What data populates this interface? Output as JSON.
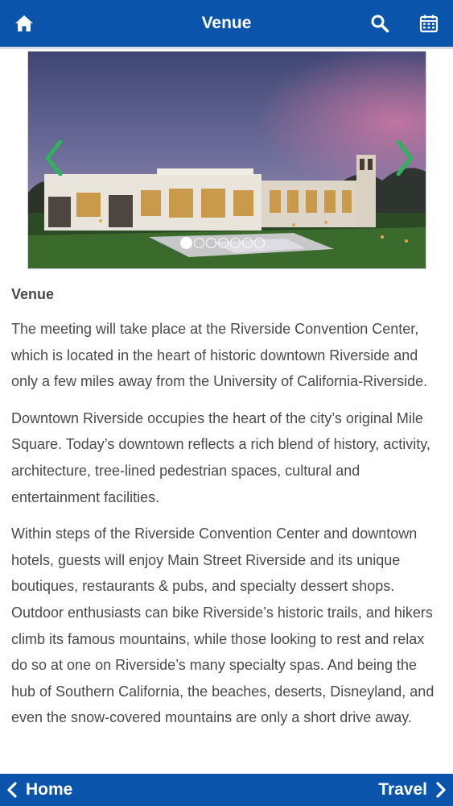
{
  "header": {
    "title": "Venue",
    "icons": [
      "home-icon",
      "search-icon",
      "calendar-icon"
    ]
  },
  "colors": {
    "bar": "#0a55ab",
    "arrow": "#2fb35a",
    "text": "#4a4a4a"
  },
  "carousel": {
    "image": "Riverside Convention Center at dusk",
    "slide_count": 7,
    "active_slide": 1
  },
  "content": {
    "heading": "Venue",
    "paragraphs": [
      "The meeting will take place at the Riverside Convention Center, which is located in the heart of historic downtown Riverside and only a few miles away from the University of California-Riverside.",
      "Downtown Riverside occupies the heart of the city’s original Mile Square. Today’s downtown reflects a rich blend of history, activity, architecture, tree-lined pedestrian spaces, cultural and entertainment facilities.",
      "Within steps of the Riverside Convention Center and downtown hotels, guests will enjoy Main Street Riverside and its unique boutiques, restaurants & pubs, and specialty dessert shops. Outdoor enthusiasts can bike Riverside’s historic trails, and hikers climb its famous mountains, while those looking to rest and relax do so at one on Riverside’s many specialty spas. And being the hub of Southern California, the beaches, deserts, Disneyland, and even the snow-covered mountains are only a short drive away."
    ]
  },
  "footer": {
    "back_label": "Home",
    "next_label": "Travel"
  }
}
